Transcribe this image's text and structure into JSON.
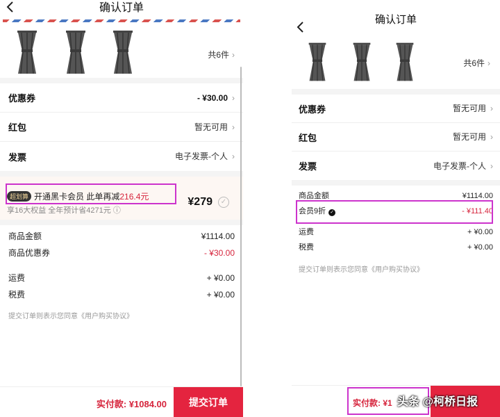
{
  "left": {
    "header_title": "确认订单",
    "product_count": "共6件",
    "rows": [
      {
        "label": "优惠券",
        "value": "- ¥30.00"
      },
      {
        "label": "红包",
        "value": "暂无可用"
      },
      {
        "label": "发票",
        "value": "电子发票-个人"
      }
    ],
    "promo": {
      "badge": "超划算",
      "text": "开通黑卡会员 此单再减",
      "amount": "216.4元",
      "subtext": "享16大权益 全年预计省4271元 ⓘ",
      "price": "¥279"
    },
    "summary": [
      {
        "label": "商品金额",
        "value": "¥1114.00"
      },
      {
        "label": "商品优惠券",
        "value": "- ¥30.00"
      }
    ],
    "summary2": [
      {
        "label": "运费",
        "value": "+ ¥0.00"
      },
      {
        "label": "税费",
        "value": "+ ¥0.00"
      }
    ],
    "agreement": "提交订单则表示您同意《用户购买协议》",
    "pay_label": "实付款: ¥1084.00",
    "submit_label": "提交订单"
  },
  "right": {
    "header_title": "确认订单",
    "product_count": "共6件",
    "rows": [
      {
        "label": "优惠券",
        "value": "暂无可用"
      },
      {
        "label": "红包",
        "value": "暂无可用"
      },
      {
        "label": "发票",
        "value": "电子发票-个人"
      }
    ],
    "summary": [
      {
        "label": "商品金额",
        "value": "¥1114.00"
      },
      {
        "label": "会员9折",
        "value": "- ¥111.40"
      },
      {
        "label": "运费",
        "value": "+ ¥0.00"
      },
      {
        "label": "税费",
        "value": "+ ¥0.00"
      }
    ],
    "agreement": "提交订单则表示您同意《用户购买协议》",
    "pay_label": "实付款: ¥1",
    "submit_label": ""
  },
  "watermark": "头条 @柯桥日报",
  "colors": {
    "accent": "#e4243f",
    "highlight": "#cc33cc",
    "discount": "#d6243c"
  }
}
